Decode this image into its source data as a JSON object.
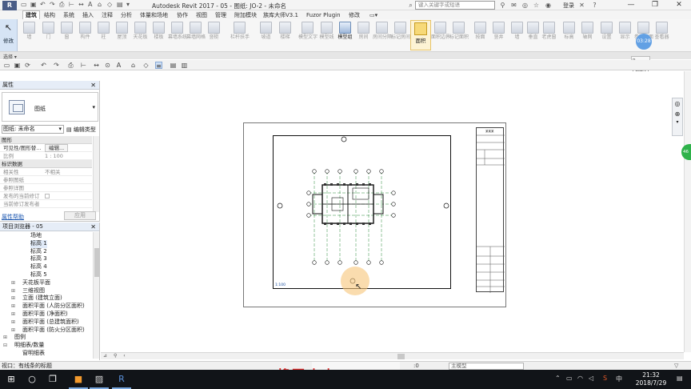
{
  "titlebar": {
    "app_logo": "R",
    "title": "Autodesk Revit 2017 -    05 - 图纸: JO-2 - 未命名",
    "search_placeholder": "键入关键字或短语",
    "login": "登录",
    "window_controls": [
      "—",
      "❐",
      "✕"
    ]
  },
  "ribbon": {
    "tabs": [
      "建筑",
      "结构",
      "系统",
      "插入",
      "注释",
      "分析",
      "体量和场地",
      "协作",
      "视图",
      "管理",
      "附加模块",
      "族库大师V3.1",
      "Fuzor Plugin",
      "修改"
    ],
    "modify_label": "修改",
    "select_label": "选择 ▾",
    "buttons": [
      "墙",
      "门",
      "窗",
      "构件",
      "柱",
      "屋顶",
      "天花板",
      "楼板",
      "幕墙系统",
      "幕墙网格",
      "竖梃",
      "栏杆扶手",
      "坡道",
      "楼梯",
      "模型文字",
      "模型线",
      "模型组",
      "房间",
      "房间分隔",
      "标记房间",
      "面积边界",
      "标记面积",
      "按面",
      "竖井",
      "墙",
      "垂直",
      "老虎窗",
      "标高",
      "轴网",
      "设置",
      "显示",
      "参照平面",
      "查看器"
    ],
    "active_button": "面积",
    "recorder_time": "03:28"
  },
  "recorder": {
    "mini": "P...",
    "start": "Start"
  },
  "properties": {
    "title": "属性",
    "type_name": "图纸",
    "instance_selector": "图纸: 未命名",
    "edit_type": "编辑类型",
    "rows": [
      {
        "kind": "section",
        "label": "图形"
      },
      {
        "kind": "row",
        "key": "可见性/图形替...",
        "value": "编辑..."
      },
      {
        "kind": "row",
        "key": "比例",
        "value": "1 : 100"
      },
      {
        "kind": "section",
        "label": "标识数据"
      },
      {
        "kind": "row",
        "key": "相关性",
        "value": "不相关"
      },
      {
        "kind": "row",
        "key": "参照图纸",
        "value": ""
      },
      {
        "kind": "row",
        "key": "参照详图",
        "value": ""
      },
      {
        "kind": "row",
        "key": "发布的当前修订",
        "value": ""
      },
      {
        "kind": "row",
        "key": "当前修订发布者",
        "value": ""
      }
    ],
    "help": "属性帮助",
    "apply": "应用"
  },
  "browser": {
    "title": "项目浏览器 - 05",
    "items": [
      {
        "text": "场地",
        "indent": 2,
        "expander": ""
      },
      {
        "text": "标高 1",
        "indent": 2,
        "expander": "",
        "selected": true
      },
      {
        "text": "标高 2",
        "indent": 2,
        "expander": ""
      },
      {
        "text": "标高 3",
        "indent": 2,
        "expander": ""
      },
      {
        "text": "标高 4",
        "indent": 2,
        "expander": ""
      },
      {
        "text": "标高 5",
        "indent": 2,
        "expander": ""
      },
      {
        "text": "天花板平面",
        "indent": 1,
        "expander": "⊞"
      },
      {
        "text": "三维视图",
        "indent": 1,
        "expander": "⊞"
      },
      {
        "text": "立面 (建筑立面)",
        "indent": 1,
        "expander": "⊞"
      },
      {
        "text": "面积平面 (人防分区面积)",
        "indent": 1,
        "expander": "⊞"
      },
      {
        "text": "面积平面 (净面积)",
        "indent": 1,
        "expander": "⊞"
      },
      {
        "text": "面积平面 (总建筑面积)",
        "indent": 1,
        "expander": "⊞"
      },
      {
        "text": "面积平面 (防火分区面积)",
        "indent": 1,
        "expander": "⊞"
      },
      {
        "text": "图例",
        "indent": 0,
        "expander": "⊞"
      },
      {
        "text": "明细表/数量",
        "indent": 0,
        "expander": "⊟"
      },
      {
        "text": "窗明细表",
        "indent": 1,
        "expander": ""
      }
    ]
  },
  "canvas": {
    "scale_label": "1:100",
    "titleblock_name": "某某某"
  },
  "status": {
    "text": "视口：有线条的标题",
    "zero": ":0",
    "model": "主模型",
    "watermark": "将军皮卡Q"
  },
  "taskbar": {
    "time": "21:32",
    "date": "2018/7/29",
    "lang": "中"
  }
}
